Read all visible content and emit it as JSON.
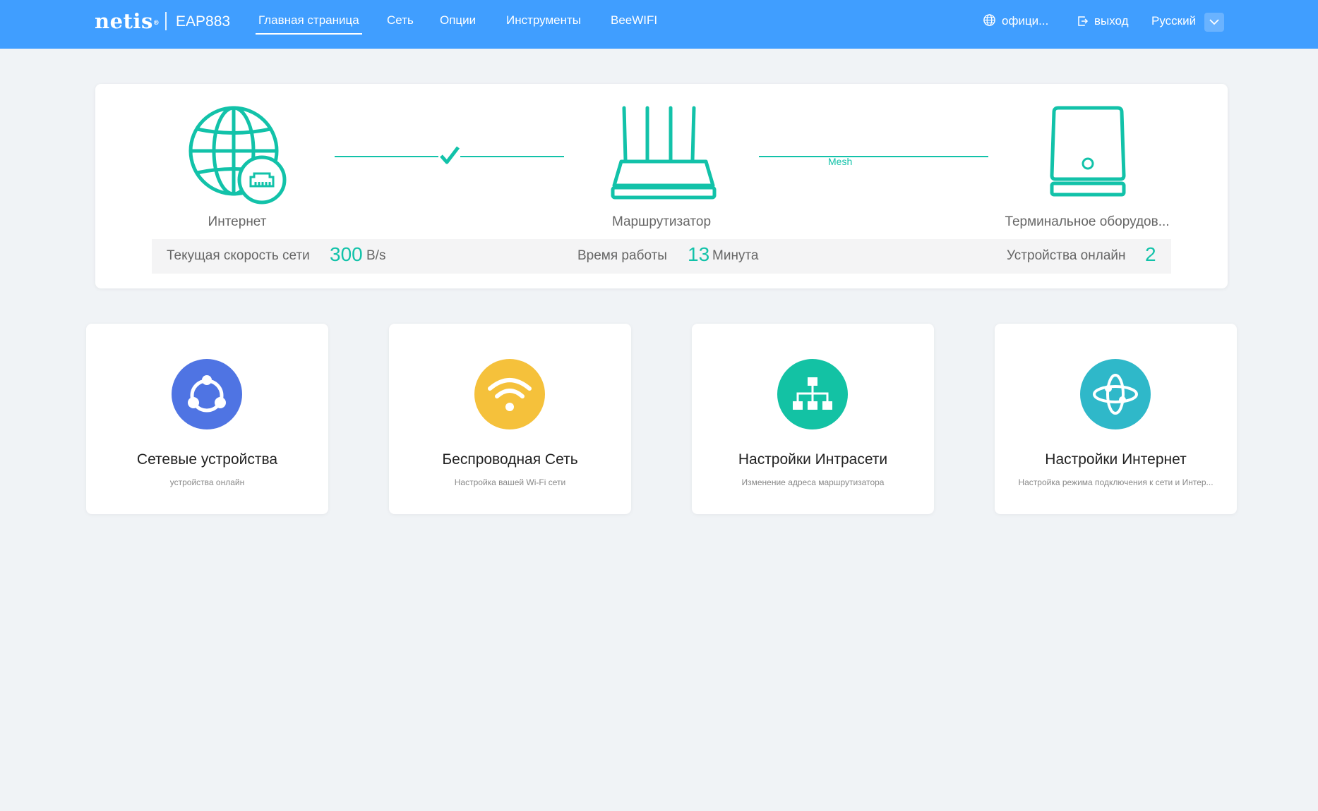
{
  "header": {
    "brand": "netis",
    "brand_mark": "®",
    "model": "EAP883",
    "nav": [
      {
        "label": "Главная страница",
        "active": true
      },
      {
        "label": "Сеть"
      },
      {
        "label": "Опции"
      },
      {
        "label": "Инструменты"
      },
      {
        "label": "BeeWIFI"
      }
    ],
    "official_label": "офици...",
    "logout_label": "выход",
    "language": "Русский"
  },
  "topology": {
    "internet_label": "Интернет",
    "router_label": "Маршрутизатор",
    "terminal_label": "Терминальное оборудов...",
    "link_status": "connected",
    "mesh_label": "Mesh"
  },
  "stats": {
    "speed_label": "Текущая скорость сети",
    "speed_value": "300",
    "speed_unit": "B/s",
    "uptime_label": "Время работы",
    "uptime_value": "13",
    "uptime_unit": "Минута",
    "devices_label": "Устройства онлайн",
    "devices_value": "2"
  },
  "cards": [
    {
      "title": "Сетевые устройства",
      "subtitle": "устройства онлайн",
      "icon": "share-nodes-icon",
      "color": "#4f74e3"
    },
    {
      "title": "Беспроводная Сеть",
      "subtitle": "Настройка вашей Wi-Fi сети",
      "icon": "wifi-icon",
      "color": "#f5c13b"
    },
    {
      "title": "Настройки Интрасети",
      "subtitle": "Изменение адреса маршрутизатора",
      "icon": "network-tree-icon",
      "color": "#13c2a4"
    },
    {
      "title": "Настройки Интернет",
      "subtitle": "Настройка режима подключения к сети и Интер...",
      "icon": "orbit-icon",
      "color": "#2fb8c9"
    }
  ],
  "colors": {
    "header": "#409eff",
    "accent": "#12c2a9",
    "background": "#f0f3f6"
  }
}
